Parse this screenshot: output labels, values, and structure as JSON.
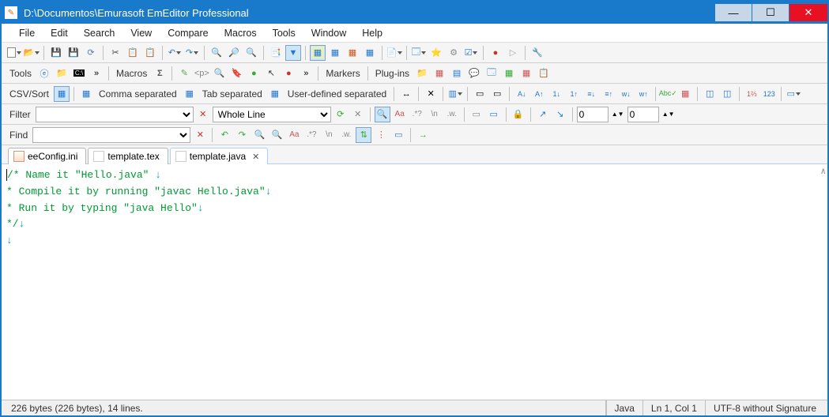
{
  "titlebar": {
    "title": "D:\\Documentos\\Emurasoft EmEditor Professional"
  },
  "menubar": {
    "items": [
      "File",
      "Edit",
      "Search",
      "View",
      "Compare",
      "Macros",
      "Tools",
      "Window",
      "Help"
    ]
  },
  "toolbar2": {
    "tools_label": "Tools",
    "macros_label": "Macros",
    "sigma": "Σ",
    "markers_label": "Markers",
    "plugins_label": "Plug-ins"
  },
  "toolbar3": {
    "csvsort_label": "CSV/Sort",
    "comma_label": "Comma separated",
    "tab_label": "Tab separated",
    "user_label": "User-defined separated"
  },
  "filterbar": {
    "label": "Filter",
    "scope_value": "Whole Line"
  },
  "findbar": {
    "label": "Find",
    "num1": "0",
    "num2": "0"
  },
  "tabs": {
    "items": [
      {
        "name": "eeConfig.ini",
        "active": false
      },
      {
        "name": "template.tex",
        "active": false
      },
      {
        "name": "template.java",
        "active": true
      }
    ]
  },
  "editor": {
    "lines": [
      {
        "text": "/* Name it \"Hello.java\" ",
        "arrow": "↓"
      },
      {
        "text": " * Compile it by running \"javac Hello.java\"",
        "arrow": "↓"
      },
      {
        "text": " * Run it by typing \"java Hello\"",
        "arrow": "↓"
      },
      {
        "text": " */",
        "arrow": "↓"
      },
      {
        "text": "",
        "arrow": "↓"
      }
    ]
  },
  "statusbar": {
    "left": "226 bytes (226 bytes), 14 lines.",
    "lang": "Java",
    "pos": "Ln 1, Col 1",
    "encoding": "UTF-8 without Signature"
  }
}
